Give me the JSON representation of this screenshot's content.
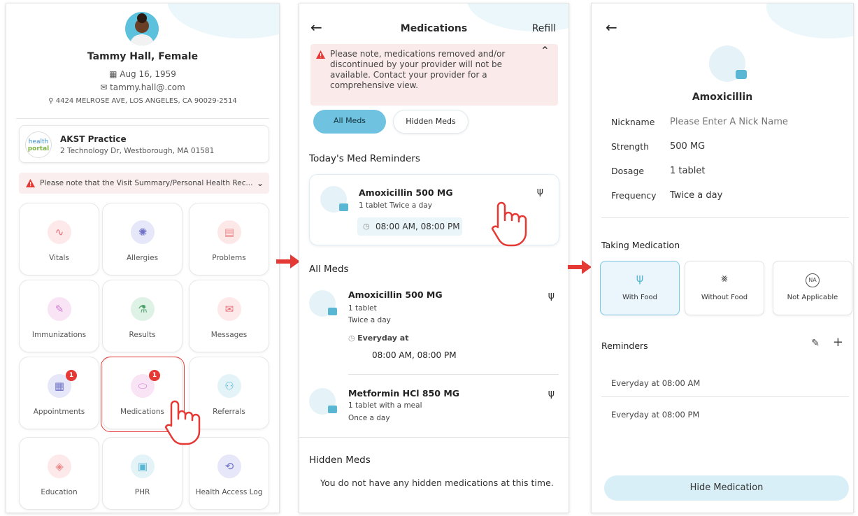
{
  "profile": {
    "name": "Tammy Hall, Female",
    "dob": "Aug 16, 1959",
    "email": "tammy.hall@.com",
    "address": "4424 MELROSE AVE, LOS ANGELES, CA 90029-2514"
  },
  "practice": {
    "logo_top": "health",
    "logo_bottom": "portal",
    "name": "AKST Practice",
    "address": "2 Technology Dr, Westborough, MA 01581"
  },
  "home_notice": "Please note that the Visit Summary/Personal Health Rec...",
  "tiles": [
    {
      "label": "Vitals",
      "color": "#fde9ea",
      "icon": "pulse-icon",
      "badge": null
    },
    {
      "label": "Allergies",
      "color": "#e6e7f8",
      "icon": "allergy-icon",
      "badge": null
    },
    {
      "label": "Problems",
      "color": "#fde8e8",
      "icon": "problems-icon",
      "badge": null
    },
    {
      "label": "Immunizations",
      "color": "#f8e4f5",
      "icon": "syringe-icon",
      "badge": null
    },
    {
      "label": "Results",
      "color": "#dff2e6",
      "icon": "flask-icon",
      "badge": null
    },
    {
      "label": "Messages",
      "color": "#fde9ea",
      "icon": "envelope-icon",
      "badge": null
    },
    {
      "label": "Appointments",
      "color": "#e6e7f8",
      "icon": "calendar-icon",
      "badge": "1"
    },
    {
      "label": "Medications",
      "color": "#f8e4f5",
      "icon": "pills-icon",
      "badge": "1"
    },
    {
      "label": "Referrals",
      "color": "#e3f3f7",
      "icon": "referral-icon",
      "badge": null
    },
    {
      "label": "Education",
      "color": "#fde9ea",
      "icon": "graduation-icon",
      "badge": null
    },
    {
      "label": "PHR",
      "color": "#e3f3f7",
      "icon": "phr-icon",
      "badge": null
    },
    {
      "label": "Health Access Log",
      "color": "#e6e7f8",
      "icon": "log-icon",
      "badge": null
    }
  ],
  "medications": {
    "title": "Medications",
    "refill": "Refill",
    "notice": "Please note, medications removed and/or discontinued by your provider will not be available. Contact your provider for a comprehensive view.",
    "tab_all": "All Meds",
    "tab_hidden": "Hidden Meds",
    "reminders_heading": "Today's Med Reminders",
    "reminder": {
      "name": "Amoxicillin 500 MG",
      "detail": "1 tablet Twice a day",
      "time": "08:00 AM, 08:00 PM"
    },
    "all_heading": "All Meds",
    "all": [
      {
        "name": "Amoxicillin 500 MG",
        "line1": "1 tablet",
        "line2": "Twice a day",
        "schedule": "Everyday at",
        "time": "08:00 AM, 08:00 PM"
      },
      {
        "name": "Metformin HCl 850 MG",
        "line1": "1 tablet with a meal",
        "line2": "Once a day"
      }
    ],
    "hidden_heading": "Hidden Meds",
    "hidden_empty": "You do not have any hidden medications at this time."
  },
  "detail": {
    "name": "Amoxicillin",
    "nickname_label": "Nickname",
    "nickname_placeholder": "Please Enter A Nick Name",
    "strength_label": "Strength",
    "strength": "500 MG",
    "dosage_label": "Dosage",
    "dosage": "1 tablet",
    "frequency_label": "Frequency",
    "frequency": "Twice a day",
    "taking_heading": "Taking Medication",
    "opt_with": "With Food",
    "opt_without": "Without Food",
    "opt_na": "Not Applicable",
    "na_badge": "NA",
    "reminders_heading": "Reminders",
    "reminders": [
      "Everyday at 08:00 AM",
      "Everyday at 08:00 PM"
    ],
    "hide_button": "Hide Medication"
  },
  "colors": {
    "accent": "#5ab7d4",
    "alert": "#e53935",
    "selected_pill": "#6fc3e0"
  }
}
